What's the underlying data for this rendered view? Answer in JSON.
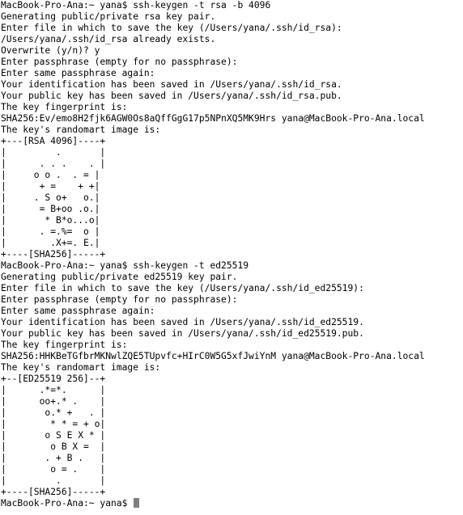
{
  "terminal": {
    "lines": [
      "MacBook-Pro-Ana:~ yana$ ssh-keygen -t rsa -b 4096",
      "Generating public/private rsa key pair.",
      "Enter file in which to save the key (/Users/yana/.ssh/id_rsa):",
      "/Users/yana/.ssh/id_rsa already exists.",
      "Overwrite (y/n)? y",
      "Enter passphrase (empty for no passphrase):",
      "Enter same passphrase again:",
      "Your identification has been saved in /Users/yana/.ssh/id_rsa.",
      "Your public key has been saved in /Users/yana/.ssh/id_rsa.pub.",
      "The key fingerprint is:",
      "SHA256:Ev/emo8H2fjk6AGW0Os8aQffGgG17p5NPnXQ5MK9Hrs yana@MacBook-Pro-Ana.local",
      "The key's randomart image is:",
      "+---[RSA 4096]----+",
      "|         .       |",
      "|      . . .    . |",
      "|     o o .  . = |",
      "|      + =    + +|",
      "|     . S o+   o.|",
      "|      = B+oo .o.|",
      "|       * B*o...o|",
      "|      . =.%=  o |",
      "|        .X+=. E.|",
      "+----[SHA256]-----+",
      "MacBook-Pro-Ana:~ yana$ ssh-keygen -t ed25519",
      "Generating public/private ed25519 key pair.",
      "Enter file in which to save the key (/Users/yana/.ssh/id_ed25519):",
      "Enter passphrase (empty for no passphrase):",
      "Enter same passphrase again:",
      "Your identification has been saved in /Users/yana/.ssh/id_ed25519.",
      "Your public key has been saved in /Users/yana/.ssh/id_ed25519.pub.",
      "The key fingerprint is:",
      "SHA256:HHKBeTGfbrMKNwlZQE5TUpvfc+HIrC0W5G5xfJwiYnM yana@MacBook-Pro-Ana.local",
      "The key's randomart image is:",
      "+--[ED25519 256]--+",
      "|      .*=*.      |",
      "|      oo+.* .    |",
      "|       o.* +   . |",
      "|        * * = + o|",
      "|       o S E X * |",
      "|        o B X =  |",
      "|       . + B .   |",
      "|        o = .    |",
      "|         .       |",
      "+----[SHA256]-----+"
    ],
    "prompt": "MacBook-Pro-Ana:~ yana$ "
  }
}
